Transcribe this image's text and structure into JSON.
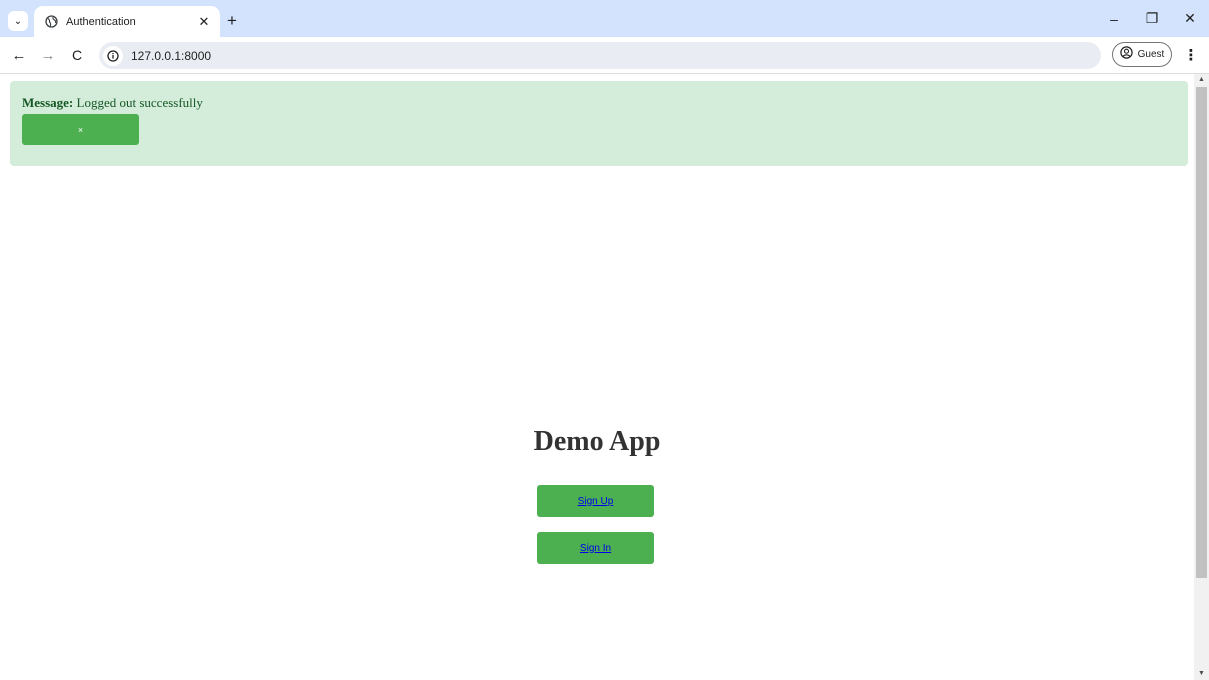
{
  "browser": {
    "tab": {
      "title": "Authentication",
      "close": "✕"
    },
    "new_tab": "+",
    "window_controls": {
      "minimize": "–",
      "restore": "❐",
      "close": "✕"
    },
    "nav": {
      "back": "←",
      "forward": "→",
      "reload": "C"
    },
    "url": "127.0.0.1:8000",
    "profile": {
      "label": "Guest"
    },
    "menu": "⋮"
  },
  "alert": {
    "label": "Message:",
    "text": "Logged out successfully",
    "close_label": "×",
    "colors": {
      "background": "#d4edda",
      "text": "#155724",
      "button": "#4caf50"
    }
  },
  "main": {
    "title": "Demo App",
    "signup_label": "Sign Up",
    "signin_label": "Sign In",
    "accent_color": "#4caf50"
  }
}
